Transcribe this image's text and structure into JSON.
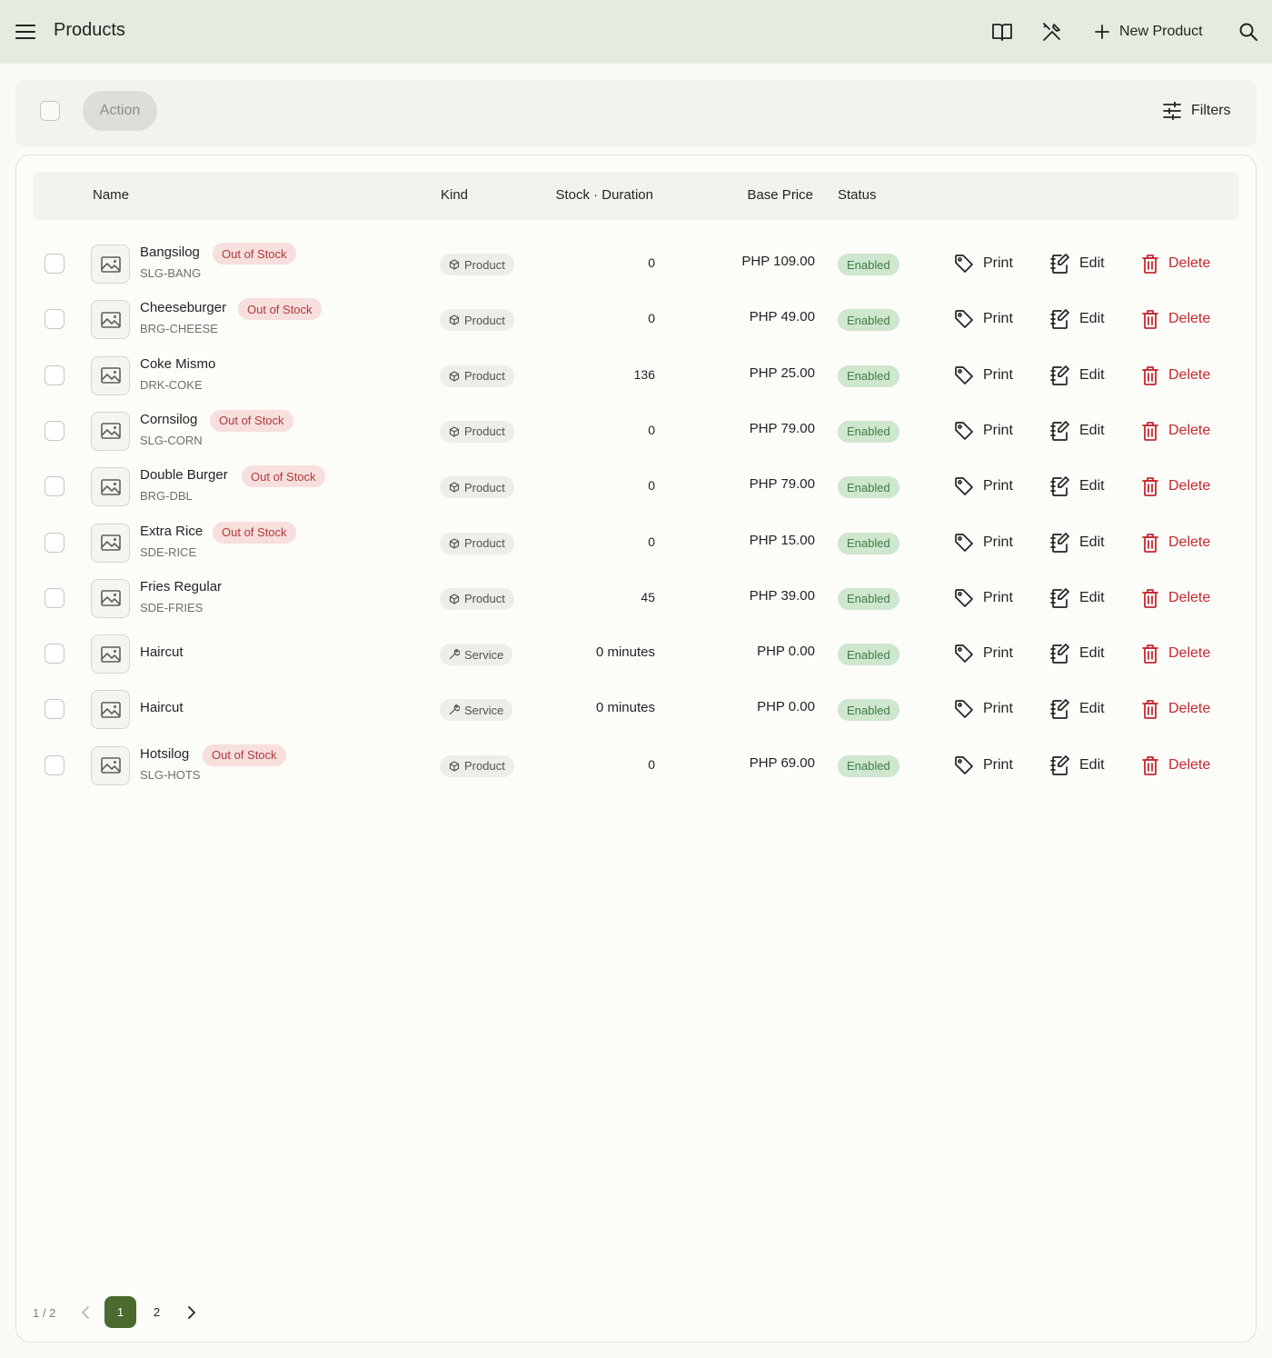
{
  "header": {
    "title": "Products",
    "new_product_label": "New Product"
  },
  "toolbar": {
    "action_label": "Action",
    "filters_label": "Filters"
  },
  "table": {
    "columns": {
      "name": "Name",
      "kind": "Kind",
      "stock": "Stock · Duration",
      "price": "Base Price",
      "status": "Status"
    },
    "rows": [
      {
        "name": "Bangsilog",
        "sku": "SLG-BANG",
        "badge": "Out of Stock",
        "kind": "Product",
        "stock": "0",
        "price": "PHP 109.00",
        "status": "Enabled"
      },
      {
        "name": "Cheeseburger",
        "sku": "BRG-CHEESE",
        "badge": "Out of Stock",
        "kind": "Product",
        "stock": "0",
        "price": "PHP 49.00",
        "status": "Enabled"
      },
      {
        "name": "Coke Mismo",
        "sku": "DRK-COKE",
        "badge": "",
        "kind": "Product",
        "stock": "136",
        "price": "PHP 25.00",
        "status": "Enabled"
      },
      {
        "name": "Cornsilog",
        "sku": "SLG-CORN",
        "badge": "Out of Stock",
        "kind": "Product",
        "stock": "0",
        "price": "PHP 79.00",
        "status": "Enabled"
      },
      {
        "name": "Double Burger",
        "sku": "BRG-DBL",
        "badge": "Out of Stock",
        "kind": "Product",
        "stock": "0",
        "price": "PHP 79.00",
        "status": "Enabled"
      },
      {
        "name": "Extra Rice",
        "sku": "SDE-RICE",
        "badge": "Out of Stock",
        "kind": "Product",
        "stock": "0",
        "price": "PHP 15.00",
        "status": "Enabled"
      },
      {
        "name": "Fries Regular",
        "sku": "SDE-FRIES",
        "badge": "",
        "kind": "Product",
        "stock": "45",
        "price": "PHP 39.00",
        "status": "Enabled"
      },
      {
        "name": "Haircut",
        "sku": "",
        "badge": "",
        "kind": "Service",
        "stock": "0 minutes",
        "price": "PHP 0.00",
        "status": "Enabled"
      },
      {
        "name": "Haircut",
        "sku": "",
        "badge": "",
        "kind": "Service",
        "stock": "0 minutes",
        "price": "PHP 0.00",
        "status": "Enabled"
      },
      {
        "name": "Hotsilog",
        "sku": "SLG-HOTS",
        "badge": "Out of Stock",
        "kind": "Product",
        "stock": "0",
        "price": "PHP 69.00",
        "status": "Enabled"
      }
    ],
    "actions": {
      "print": "Print",
      "edit": "Edit",
      "delete": "Delete"
    }
  },
  "pagination": {
    "info": "1 / 2",
    "pages": [
      "1",
      "2"
    ],
    "current": "1"
  },
  "icons": {
    "menu": "menu-icon",
    "book": "book-icon",
    "tools": "tools-icon",
    "plus": "plus-icon",
    "search": "search-icon",
    "filters": "sliders-icon",
    "image_placeholder": "image-icon",
    "product_kind": "box-icon",
    "service_kind": "wrench-icon",
    "print": "tag-icon",
    "edit": "edit-icon",
    "delete": "trash-icon"
  },
  "colors": {
    "topbar": "#e6ebe0",
    "accent": "#4a6a2f",
    "danger": "#c5292f",
    "enabled_bg": "#cfe6cf",
    "enabled_text": "#3f7d45",
    "oos_bg": "#f6dfdd",
    "oos_text": "#b2393b"
  }
}
